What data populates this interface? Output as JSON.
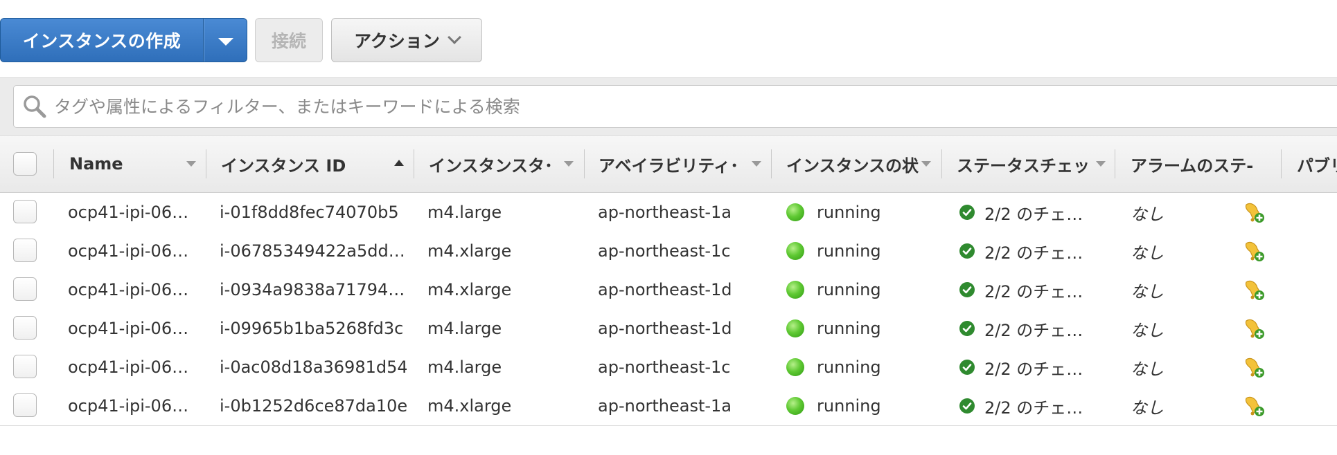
{
  "toolbar": {
    "create_label": "インスタンスの作成",
    "connect_label": "接続",
    "actions_label": "アクション"
  },
  "search": {
    "placeholder": "タグや属性によるフィルター、またはキーワードによる検索"
  },
  "table": {
    "columns": [
      {
        "label": "Name"
      },
      {
        "label": "インスタンス ID"
      },
      {
        "label": "インスタンスタ･"
      },
      {
        "label": "アベイラビリティ･"
      },
      {
        "label": "インスタンスの状"
      },
      {
        "label": "ステータスチェッ"
      },
      {
        "label": "アラームのステ-"
      },
      {
        "label": "パブリ"
      }
    ],
    "rows": [
      {
        "name": "ocp41-ipi-06…",
        "id": "i-01f8dd8fec74070b5",
        "type": "m4.large",
        "az": "ap-northeast-1a",
        "state": "running",
        "status": "2/2 のチェ…",
        "alarm": "なし"
      },
      {
        "name": "ocp41-ipi-06…",
        "id": "i-06785349422a5dd…",
        "type": "m4.xlarge",
        "az": "ap-northeast-1c",
        "state": "running",
        "status": "2/2 のチェ…",
        "alarm": "なし"
      },
      {
        "name": "ocp41-ipi-06…",
        "id": "i-0934a9838a71794…",
        "type": "m4.xlarge",
        "az": "ap-northeast-1d",
        "state": "running",
        "status": "2/2 のチェ…",
        "alarm": "なし"
      },
      {
        "name": "ocp41-ipi-06…",
        "id": "i-09965b1ba5268fd3c",
        "type": "m4.large",
        "az": "ap-northeast-1d",
        "state": "running",
        "status": "2/2 のチェ…",
        "alarm": "なし"
      },
      {
        "name": "ocp41-ipi-06…",
        "id": "i-0ac08d18a36981d54",
        "type": "m4.large",
        "az": "ap-northeast-1c",
        "state": "running",
        "status": "2/2 のチェ…",
        "alarm": "なし"
      },
      {
        "name": "ocp41-ipi-06…",
        "id": "i-0b1252d6ce87da10e",
        "type": "m4.xlarge",
        "az": "ap-northeast-1a",
        "state": "running",
        "status": "2/2 のチェ…",
        "alarm": "なし"
      }
    ]
  },
  "colors": {
    "primary": "#3a7cc7",
    "running": "#5fc933",
    "check": "#2f8a2f"
  },
  "icons": {
    "search": "search-icon",
    "state": "running-status-icon",
    "status_check": "check-icon",
    "alarm": "add-alarm-bell-icon"
  }
}
